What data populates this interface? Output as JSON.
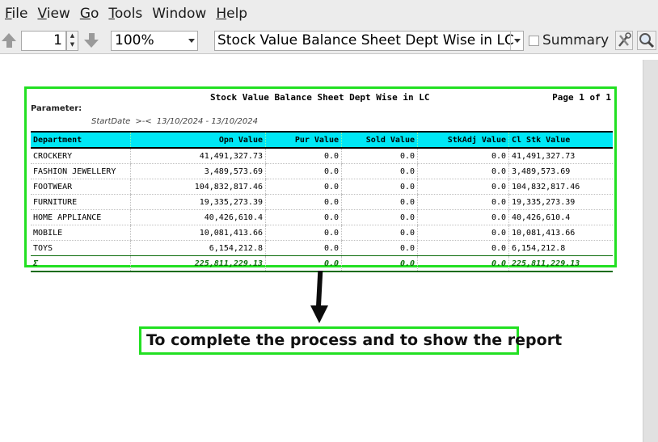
{
  "menu": {
    "items": [
      {
        "label": "File",
        "u": "F",
        "rest": "ile"
      },
      {
        "label": "View",
        "u": "V",
        "rest": "iew"
      },
      {
        "label": "Go",
        "u": "G",
        "rest": "o"
      },
      {
        "label": "Tools",
        "u": "T",
        "rest": "ools"
      },
      {
        "label": "Window",
        "u": "",
        "rest": "Window"
      },
      {
        "label": "Help",
        "u": "H",
        "rest": "elp"
      }
    ]
  },
  "toolbar": {
    "page_number": "1",
    "zoom": "100%",
    "report_name": "Stock Value Balance Sheet Dept Wise in LC",
    "summary_label": "Summary",
    "summary_checked": false
  },
  "report": {
    "title": "Stock Value Balance Sheet Dept Wise in LC",
    "page": "Page 1 of 1",
    "parameter_label": "Parameter:",
    "param_name": "StartDate",
    "param_op": ">-<",
    "param_value": "13/10/2024 - 13/10/2024",
    "columns": [
      "Department",
      "Opn Value",
      "Pur Value",
      "Sold Value",
      "StkAdj Value",
      "Cl Stk Value"
    ],
    "rows": [
      [
        "CROCKERY",
        "41,491,327.73",
        "0.0",
        "0.0",
        "0.0",
        "41,491,327.73"
      ],
      [
        "FASHION JEWELLERY",
        "3,489,573.69",
        "0.0",
        "0.0",
        "0.0",
        "3,489,573.69"
      ],
      [
        "FOOTWEAR",
        "104,832,817.46",
        "0.0",
        "0.0",
        "0.0",
        "104,832,817.46"
      ],
      [
        "FURNITURE",
        "19,335,273.39",
        "0.0",
        "0.0",
        "0.0",
        "19,335,273.39"
      ],
      [
        "HOME APPLIANCE",
        "40,426,610.4",
        "0.0",
        "0.0",
        "0.0",
        "40,426,610.4"
      ],
      [
        "MOBILE",
        "10,081,413.66",
        "0.0",
        "0.0",
        "0.0",
        "10,081,413.66"
      ],
      [
        "TOYS",
        "6,154,212.8",
        "0.0",
        "0.0",
        "0.0",
        "6,154,212.8"
      ]
    ],
    "total": [
      "Σ",
      "225,811,229.13",
      "0.0",
      "0.0",
      "0.0",
      "225,811,229.13"
    ],
    "header_color": "#00e7f5",
    "total_color": "#0a6b0a"
  },
  "annotation": {
    "text": "To complete the process and to show the report",
    "border_color": "#22e022"
  }
}
